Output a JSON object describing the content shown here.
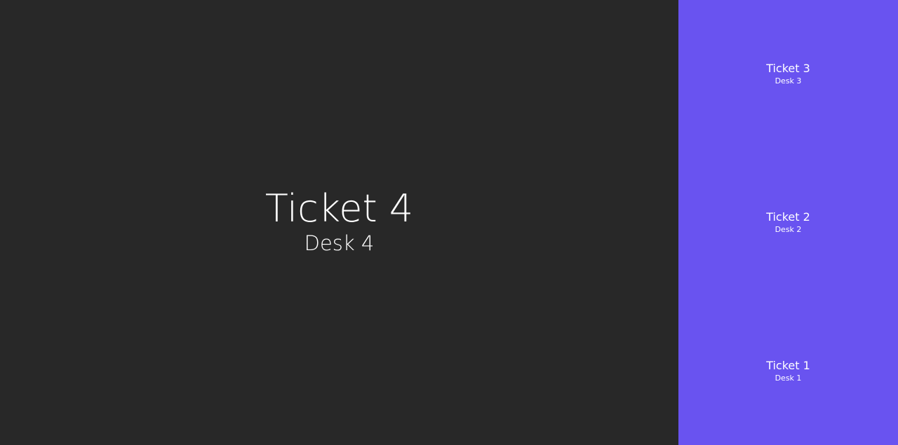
{
  "current": {
    "ticket": "Ticket 4",
    "desk": "Desk 4"
  },
  "history": [
    {
      "ticket": "Ticket 3",
      "desk": "Desk 3"
    },
    {
      "ticket": "Ticket 2",
      "desk": "Desk 2"
    },
    {
      "ticket": "Ticket 1",
      "desk": "Desk 1"
    }
  ],
  "colors": {
    "main_background": "#282828",
    "sidebar_background": "#6953f0",
    "text": "#ffffff"
  }
}
